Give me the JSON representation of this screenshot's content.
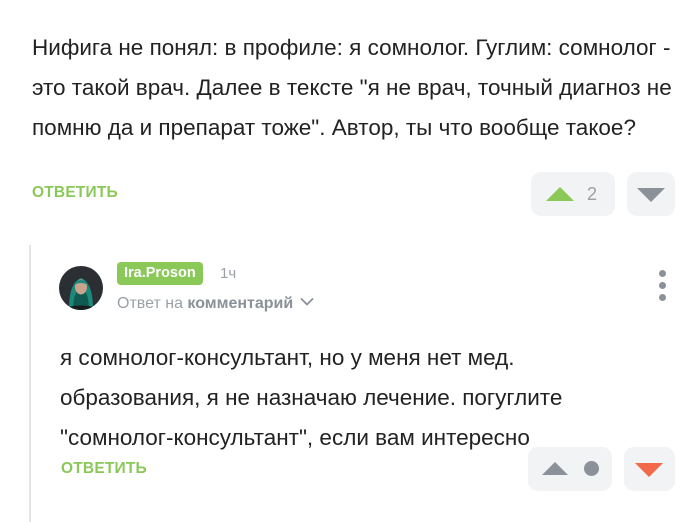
{
  "comment": {
    "text": "Нифига не понял: в профиле: я сомнолог. Гуглим: сомнолог - это такой врач. Далее в тексте \"я не врач, точный диагноз не помню да и препарат тоже\". Автор, ты что вообще такое?",
    "reply_label": "ОТВЕТИТЬ",
    "rating": "2"
  },
  "reply": {
    "username": "Ira.Proson",
    "time": "1ч",
    "reply_to_prefix": "Ответ на",
    "reply_to_target": "комментарий",
    "text": "я сомнолог-консультант, но у меня нет мед. образования, я не назначаю лечение. погуглите \"сомнолог-консультант\", если вам интересно",
    "reply_label": "ОТВЕТИТЬ"
  },
  "colors": {
    "accent_green": "#8ac858",
    "downvote_active": "#f26a4b",
    "icon_gray": "#8a9199",
    "pill_bg": "#f2f3f4"
  },
  "icons": {
    "upvote": "triangle-up-icon",
    "downvote": "triangle-down-icon",
    "more": "vertical-dots-icon",
    "chevron": "chevron-down-icon"
  }
}
